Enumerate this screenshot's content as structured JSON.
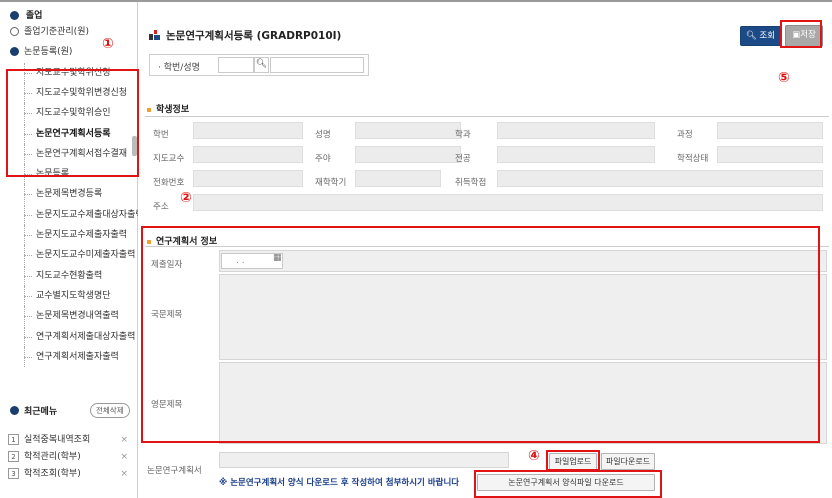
{
  "sidebar": {
    "root_label": "졸업",
    "items": [
      {
        "label": "졸업기준관리(원)",
        "selected": false
      },
      {
        "label": "논문등록(원)",
        "selected": false
      },
      {
        "label": "지도교수및학위신청",
        "selected": false
      },
      {
        "label": "지도교수및학위변경신청",
        "selected": false
      },
      {
        "label": "지도교수및학위승인",
        "selected": false
      },
      {
        "label": "논문연구계획서등록",
        "selected": true
      },
      {
        "label": "논문연구계획서접수결재",
        "selected": false
      },
      {
        "label": "논문등록",
        "selected": false
      },
      {
        "label": "논문제목변경등록",
        "selected": false
      },
      {
        "label": "논문지도교수제출대상자출력",
        "selected": false
      },
      {
        "label": "논문지도교수제출자출력",
        "selected": false
      },
      {
        "label": "논문지도교수미제출자출력",
        "selected": false
      },
      {
        "label": "지도교수현황출력",
        "selected": false
      },
      {
        "label": "교수별지도학생명단",
        "selected": false
      },
      {
        "label": "논문제목변경내역출력",
        "selected": false
      },
      {
        "label": "연구계획서제출대상자출력",
        "selected": false
      },
      {
        "label": "연구계획서제출자출력",
        "selected": false
      }
    ]
  },
  "recent": {
    "title": "최근메뉴",
    "clear_all": "전체삭제",
    "items": [
      {
        "num": "1",
        "label": "실적중복내역조회"
      },
      {
        "num": "2",
        "label": "학적관리(학부)"
      },
      {
        "num": "3",
        "label": "학적조회(학부)"
      }
    ]
  },
  "header": {
    "title": "논문연구계획서등록 (GRADRP010I)",
    "search_button": "조회",
    "save_button": "저장"
  },
  "search": {
    "label": "학번/성명"
  },
  "student_info": {
    "title": "학생정보",
    "labels": {
      "hakbun": "학번",
      "name": "성명",
      "dept": "학과",
      "course": "과정",
      "advisor": "지도교수",
      "jumin": "주야",
      "major": "전공",
      "status": "학적상태",
      "phone": "전화번호",
      "semester": "재학학기",
      "credits": "취득학점",
      "address": "주소"
    }
  },
  "plan": {
    "title": "연구계획서 정보",
    "date_label": "제출일자",
    "date_value": ". .",
    "kor_title_label": "국문제목",
    "eng_title_label": "영문제목",
    "file_label": "논문연구계획서",
    "upload_button": "파일업로드",
    "download_button": "파일다운로드",
    "notice": "※ 논문연구계획서 양식 다운로드 후 작성하여 첨부하시기 바랍니다",
    "form_download_button": "논문연구계획서 양식파일 다운로드"
  },
  "annotations": {
    "n1": "①",
    "n2": "②",
    "n4": "④",
    "n5": "⑤"
  },
  "colors": {
    "accent": "#1b4a86",
    "highlight": "#e01414",
    "notice": "#1b3f8a"
  }
}
